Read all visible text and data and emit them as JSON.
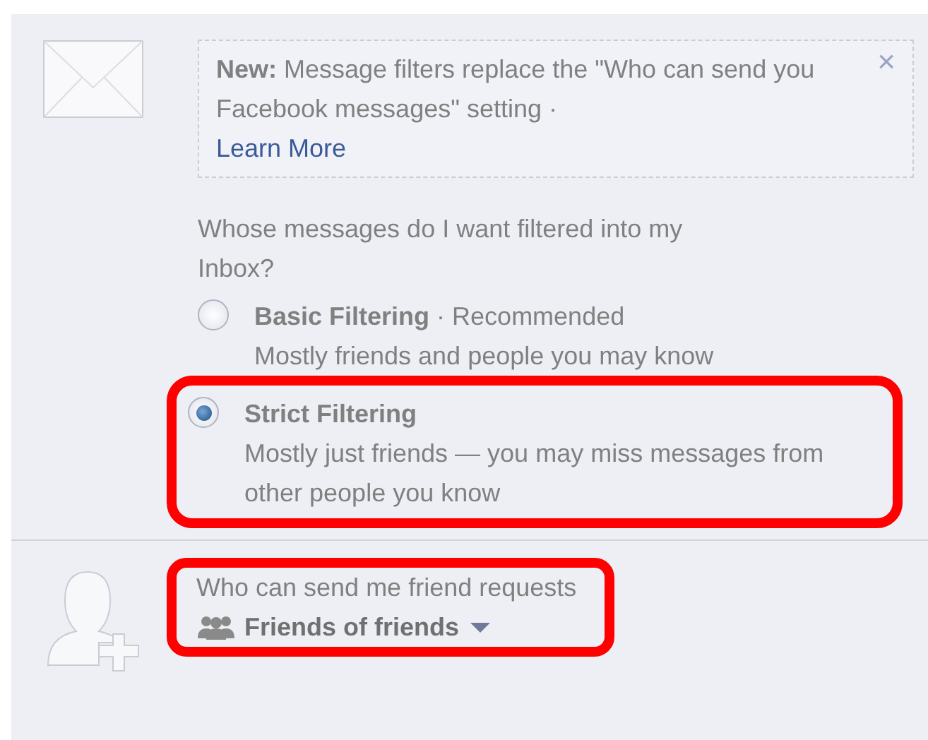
{
  "notice": {
    "label": "New:",
    "text": "Message filters replace the \"Who can send you Facebook messages\" setting ·",
    "link": "Learn More",
    "close": "×"
  },
  "filter": {
    "question": "Whose messages do I want filtered into my Inbox?",
    "options": [
      {
        "title": "Basic Filtering",
        "note": "· Recommended",
        "description": "Mostly friends and people you may know",
        "selected": false,
        "highlighted": false
      },
      {
        "title": "Strict Filtering",
        "description": "Mostly just friends — you may miss messages from other people you know",
        "selected": true,
        "highlighted": true
      }
    ]
  },
  "friend_requests": {
    "label": "Who can send me friend requests",
    "value": "Friends of friends",
    "highlighted": true
  }
}
